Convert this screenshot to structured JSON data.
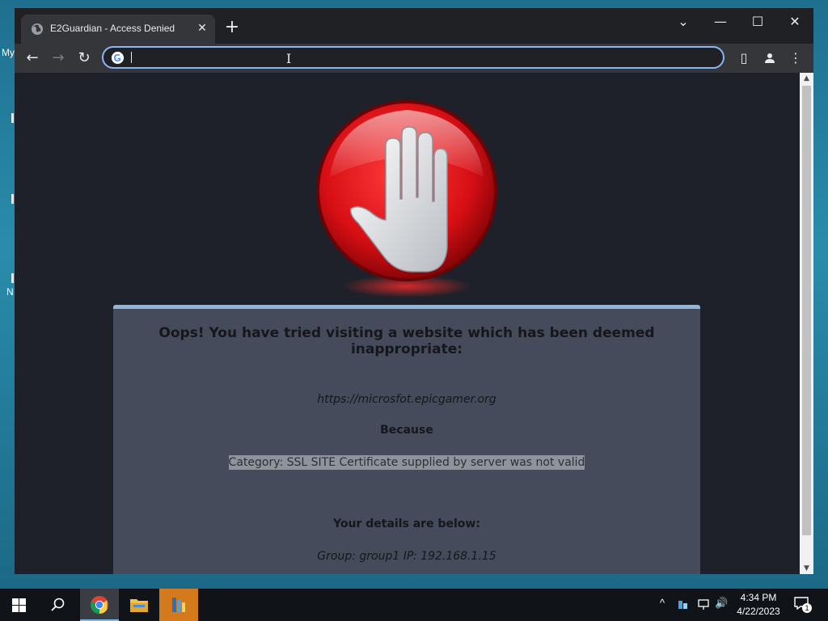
{
  "desktop": {
    "fragments": [
      "My",
      "N"
    ]
  },
  "browser": {
    "tab": {
      "title": "E2Guardian - Access Denied",
      "close_glyph": "✕"
    },
    "new_tab_glyph": "+",
    "window_controls": {
      "menu": "⌄",
      "minimize": "—",
      "maximize": "☐",
      "close": "✕"
    },
    "toolbar": {
      "back": "←",
      "forward": "→",
      "reload": "↻",
      "side_panel": "▯",
      "profile": "👤",
      "menu": "⋮"
    },
    "omnibox": {
      "value": "",
      "placeholder": ""
    }
  },
  "page": {
    "heading": "Oops! You have tried visiting a website which has been deemed inappropriate:",
    "url": "https://microsfot.epicgamer.org",
    "because": "Because",
    "reason": "Category: SSL SITE   Certificate supplied by server was not valid",
    "details_heading": "Your details are below:",
    "group_ip": "Group: group1   IP: 192.168.1.15"
  },
  "scrollbar": {
    "up": "▲",
    "down": "▼"
  },
  "taskbar": {
    "tray_chevron": "^",
    "volume": "🔊",
    "time": "4:34 PM",
    "date": "4/22/2023",
    "notification_count": "1"
  },
  "colors": {
    "accent": "#8ab4f8",
    "panel_bg": "#454b5a",
    "panel_border": "#8fb6dc",
    "stop_red": "#e0141a",
    "taskbar_orange": "#d57a1c"
  }
}
